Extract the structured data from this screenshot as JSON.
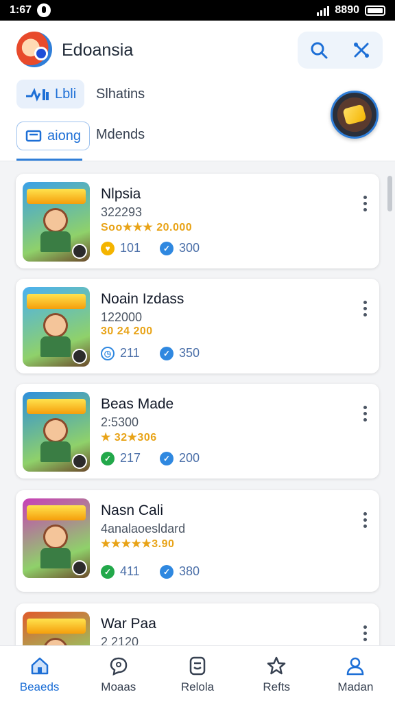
{
  "status": {
    "time": "1:67",
    "battery_text": "8890"
  },
  "app": {
    "title": "Edoansia"
  },
  "header_actions": [
    {
      "icon": "search-icon"
    },
    {
      "icon": "tools-icon"
    }
  ],
  "tabs": [
    {
      "label": "Lbli",
      "icon": "chart-icon",
      "selected": true
    },
    {
      "label": "Slhatins",
      "selected": false
    },
    {
      "label": "aiong",
      "icon": "card-icon",
      "selected": true
    },
    {
      "label": "Mdends",
      "selected": false
    }
  ],
  "colors": {
    "accent": "#2f7ed8",
    "star": "#e8a317",
    "green": "#22a84a",
    "blue_check": "#2f88e0"
  },
  "games": [
    {
      "title": "Nlpsia",
      "subtitle": "322293",
      "rating": "Soo★★★ 20.000",
      "stat1_icon": "heart-icon",
      "stat1": "101",
      "stat2_icon": "check-icon",
      "stat2": "300",
      "theme": "#3aa0e8"
    },
    {
      "title": "Noain Izdass",
      "subtitle": "122000",
      "rating": "30 24 200",
      "stat1_icon": "clock-icon",
      "stat1": "211",
      "stat2_icon": "check-icon",
      "stat2": "350",
      "theme": "#4ab0f0"
    },
    {
      "title": "Beas Made",
      "subtitle": "2:5300",
      "rating": "★ 32★306",
      "stat1_icon": "check-green-icon",
      "stat1": "217",
      "stat2_icon": "check-icon",
      "stat2": "200",
      "theme": "#2e8fdc"
    },
    {
      "title": "Nasn Cali",
      "subtitle": "4analaoesldard",
      "rating": "★★★★★3.90",
      "stat1_icon": "check-green-icon",
      "stat1": "411",
      "stat2_icon": "check-icon",
      "stat2": "380",
      "theme": "#c83fb8"
    },
    {
      "title": "War Paa",
      "subtitle": "2 2120",
      "theme": "#e05a2a"
    }
  ],
  "nav": [
    {
      "label": "Beaeds",
      "icon": "home-icon",
      "active": true
    },
    {
      "label": "Moaas",
      "icon": "chat-icon",
      "active": false
    },
    {
      "label": "Relola",
      "icon": "document-icon",
      "active": false
    },
    {
      "label": "Refts",
      "icon": "star-icon",
      "active": false
    },
    {
      "label": "Madan",
      "icon": "user-icon",
      "active": false
    }
  ]
}
